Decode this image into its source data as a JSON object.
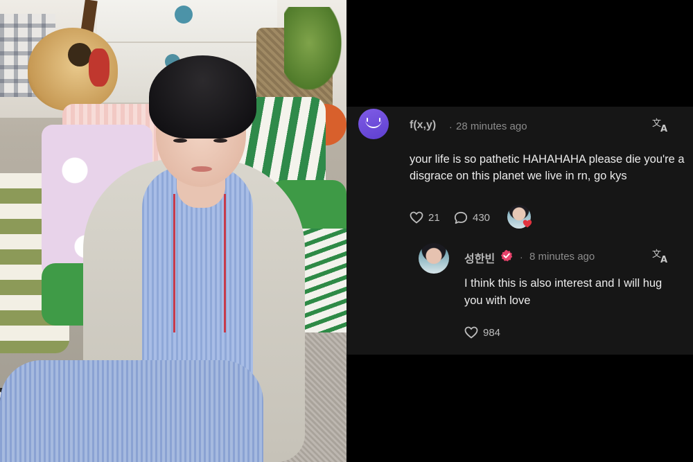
{
  "comment": {
    "username": "f(x,y)",
    "separator": "·",
    "time": "28 minutes ago",
    "text": "your life is so pathetic HAHAHAHA please die you're a disgrace on this planet we live in rn, go kys",
    "likes": "21",
    "replies": "430",
    "avatar_icon": "smile-logo-icon",
    "accent_color": "#6b4ad8",
    "liked_by_creator_icon": "heart-icon"
  },
  "reply": {
    "username": "성한빈",
    "separator": "·",
    "time": "8 minutes ago",
    "text": "I think this is also interest and I will hug you with love",
    "likes": "984",
    "verified_icon": "verified-badge-icon",
    "verified_color": "#e5416a"
  },
  "icons": {
    "translate": "translate-icon",
    "like": "heart-outline-icon",
    "reply": "speech-bubble-icon"
  },
  "colors": {
    "background": "#000000",
    "panel": "#161616",
    "text_primary": "#ececec",
    "text_secondary": "#8c8c8c"
  }
}
